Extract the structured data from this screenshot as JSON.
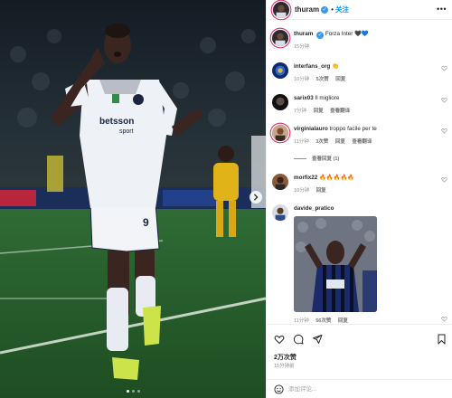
{
  "post": {
    "author": "thuram",
    "follow_label": "关注",
    "separator": "•",
    "more_icon": "more-horizontal-icon",
    "image_caption": "player celebrating on pitch"
  },
  "media": {
    "sponsor_text": "betsson",
    "sponsor_sub": "sport",
    "shirt_number": "9",
    "slide_count": 3,
    "active_slide": 1
  },
  "comments": [
    {
      "user": "thuram",
      "text": "Forza Inter 🖤💙",
      "time": "15分钟",
      "likes": "",
      "reply": "",
      "translate": ""
    },
    {
      "user": "interfans_org",
      "text": "👏",
      "time": "10分钟",
      "likes": "5次赞",
      "reply": "回复",
      "translate": ""
    },
    {
      "user": "sarix03",
      "text": "Il migliore",
      "time": "7分钟",
      "likes": "",
      "reply": "回复",
      "translate": "查看翻译"
    },
    {
      "user": "virginialauro",
      "text": "troppo facile per te",
      "time": "11分钟",
      "likes": "3次赞",
      "reply": "回复",
      "translate": "查看翻译"
    },
    {
      "user": "morfix22",
      "text": "🔥🔥🔥🔥🔥",
      "time": "10分钟",
      "likes": "",
      "reply": "回复",
      "translate": ""
    },
    {
      "user": "davide_pratico",
      "text": "",
      "time": "11分钟",
      "likes": "56次赞",
      "reply": "回复",
      "translate": ""
    }
  ],
  "view_replies": "查看回复 (1)",
  "actions": {
    "likes_count": "2万次赞",
    "posted_time": "15分钟前"
  },
  "compose": {
    "placeholder": "添加评论..."
  },
  "colors": {
    "link_blue": "#0095f6",
    "verified_blue": "#3897f0",
    "meta_gray": "#8e8e8e",
    "story_ring": "#e1306c"
  }
}
